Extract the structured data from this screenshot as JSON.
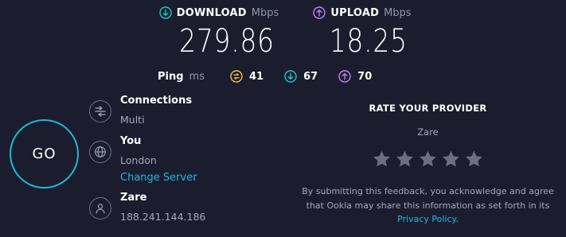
{
  "results": {
    "download": {
      "label": "DOWNLOAD",
      "unit": "Mbps",
      "value": "279.86",
      "icon": "download-icon",
      "color": "#20c7c9"
    },
    "upload": {
      "label": "UPLOAD",
      "unit": "Mbps",
      "value": "18.25",
      "icon": "upload-icon",
      "color": "#b486f0"
    }
  },
  "ping": {
    "label": "Ping",
    "unit": "ms",
    "idle": {
      "value": "41",
      "icon": "idle-latency-icon",
      "color": "#f0c24b"
    },
    "download": {
      "value": "67",
      "icon": "download-latency-icon",
      "color": "#20c7c9"
    },
    "upload": {
      "value": "70",
      "icon": "upload-latency-icon",
      "color": "#b486f0"
    }
  },
  "go_button": {
    "label": "GO",
    "color": "#20b8d6"
  },
  "connections": {
    "title": "Connections",
    "value": "Multi",
    "icon": "connections-icon"
  },
  "server": {
    "title": "You",
    "location": "London",
    "change_label": "Change Server",
    "icon": "globe-icon"
  },
  "isp": {
    "title": "Zare",
    "ip": "188.241.144.186",
    "icon": "user-icon"
  },
  "rating": {
    "title": "RATE YOUR PROVIDER",
    "provider": "Zare",
    "stars": 5,
    "star_color": "#6b6f82",
    "disclaimer": "By submitting this feedback, you acknowledge and agree that Ookla may share this information as set forth in its",
    "policy_link": "Privacy Policy",
    "period": "."
  }
}
